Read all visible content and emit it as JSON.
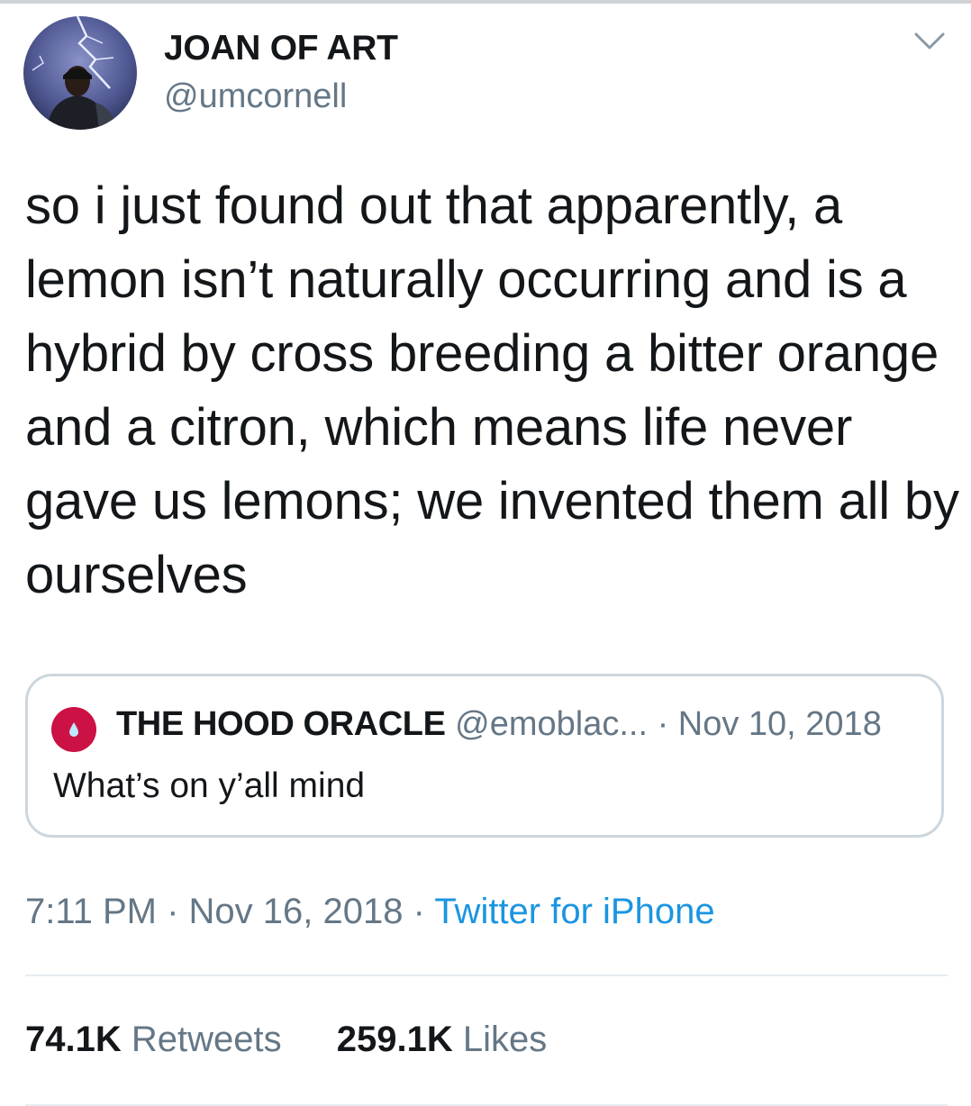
{
  "tweet": {
    "author": {
      "display_name": "JOAN OF ART",
      "handle": "@umcornell",
      "avatar_icon": "profile-photo"
    },
    "menu_icon": "chevron-down-icon",
    "text": "so i just found out that apparently, a lemon isn’t naturally occurring and is a hybrid by cross breeding a bitter orange and a citron, which means life never gave us lemons; we invented them all by ourselves",
    "quoted": {
      "display_name": "THE HOOD ORACLE",
      "handle_date": "@emoblac... · Nov 10, 2018",
      "text": "What’s on y’all mind",
      "avatar_color": "#cc1144",
      "avatar_icon": "droplet-icon"
    },
    "time_date": "7:11 PM · Nov 16, 2018 · ",
    "source": "Twitter for iPhone",
    "stats": {
      "retweets_count": "74.1K",
      "retweets_label": " Retweets",
      "likes_count": "259.1K",
      "likes_label": " Likes"
    }
  },
  "colors": {
    "text": "#14171a",
    "secondary": "#657786",
    "link": "#1b95e0",
    "border": "#ccd6dd"
  }
}
